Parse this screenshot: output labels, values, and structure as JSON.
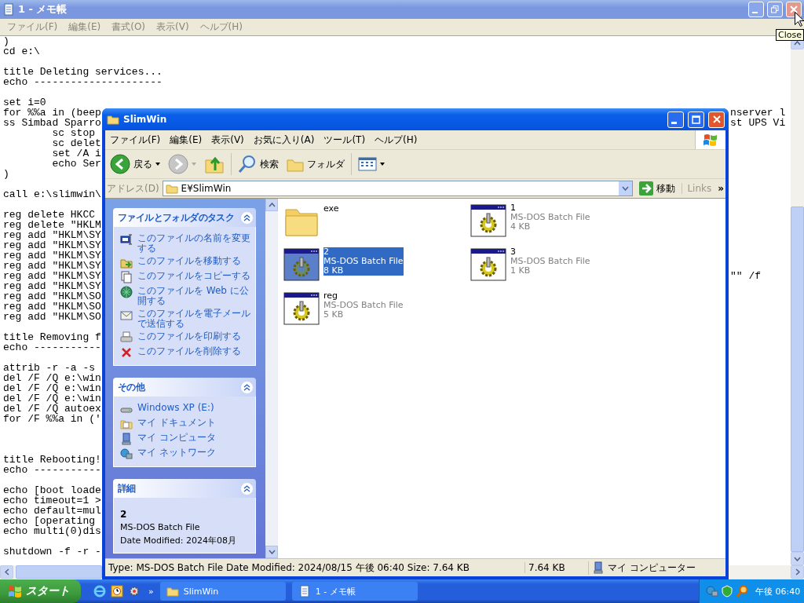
{
  "notepad": {
    "title": "1 - メモ帳",
    "menu": [
      "ファイル(F)",
      "編集(E)",
      "書式(O)",
      "表示(V)",
      "ヘルプ(H)"
    ],
    "tooltip": "Close",
    "lines": [
      {
        "kind": "code",
        "text": ")"
      },
      {
        "kind": "code",
        "text": "cd e:\\"
      },
      {
        "kind": "blank"
      },
      {
        "kind": "code",
        "text": "title Deleting services..."
      },
      {
        "kind": "code",
        "text": "echo ---------------------"
      },
      {
        "kind": "blank"
      },
      {
        "kind": "code",
        "text": "set i=0"
      },
      {
        "kind": "code",
        "text": "for %%a in (beep",
        "tail": "nserver l"
      },
      {
        "kind": "code",
        "text": "ss Simbad Sparro",
        "tail": "st UPS Vi"
      },
      {
        "kind": "code",
        "text": "        sc stop"
      },
      {
        "kind": "code",
        "text": "        sc delet"
      },
      {
        "kind": "code",
        "text": "        set /A i"
      },
      {
        "kind": "code",
        "text": "        echo Ser"
      },
      {
        "kind": "code",
        "text": ")"
      },
      {
        "kind": "blank"
      },
      {
        "kind": "code",
        "text": "call e:\\slimwin\\"
      },
      {
        "kind": "blank"
      },
      {
        "kind": "code",
        "text": "reg delete HKCC"
      },
      {
        "kind": "code",
        "text": "reg delete \"HKLM"
      },
      {
        "kind": "code",
        "text": "reg add \"HKLM\\SY"
      },
      {
        "kind": "code",
        "text": "reg add \"HKLM\\SY"
      },
      {
        "kind": "code",
        "text": "reg add \"HKLM\\SY"
      },
      {
        "kind": "code",
        "text": "reg add \"HKLM\\SY"
      },
      {
        "kind": "code",
        "text": "reg add \"HKLM\\SY",
        "tail": "\"\" /f"
      },
      {
        "kind": "code",
        "text": "reg add \"HKLM\\SY"
      },
      {
        "kind": "code",
        "text": "reg add \"HKLM\\SO"
      },
      {
        "kind": "code",
        "text": "reg add \"HKLM\\SO"
      },
      {
        "kind": "code",
        "text": "reg add \"HKLM\\SO"
      },
      {
        "kind": "blank"
      },
      {
        "kind": "code",
        "text": "title Removing f"
      },
      {
        "kind": "code",
        "text": "echo -----------"
      },
      {
        "kind": "blank"
      },
      {
        "kind": "code",
        "text": "attrib -r -a -s"
      },
      {
        "kind": "code",
        "text": "del /F /Q e:\\win"
      },
      {
        "kind": "code",
        "text": "del /F /Q e:\\win"
      },
      {
        "kind": "code",
        "text": "del /F /Q e:\\win"
      },
      {
        "kind": "code",
        "text": "del /F /Q autoex"
      },
      {
        "kind": "code",
        "text": "for /F %%a in ('"
      },
      {
        "kind": "blank"
      },
      {
        "kind": "blank"
      },
      {
        "kind": "blank"
      },
      {
        "kind": "code",
        "text": "title Rebooting!"
      },
      {
        "kind": "code",
        "text": "echo -----------"
      },
      {
        "kind": "blank"
      },
      {
        "kind": "code",
        "text": "echo [boot loade"
      },
      {
        "kind": "code",
        "text": "echo timeout=1 >"
      },
      {
        "kind": "code",
        "text": "echo default=mul"
      },
      {
        "kind": "code",
        "text": "echo [operating"
      },
      {
        "kind": "code",
        "text": "echo multi(0)dis"
      },
      {
        "kind": "blank"
      },
      {
        "kind": "code",
        "text": "shutdown -f -r -"
      }
    ]
  },
  "explorer": {
    "title": "SlimWin",
    "menu": [
      "ファイル(F)",
      "編集(E)",
      "表示(V)",
      "お気に入り(A)",
      "ツール(T)",
      "ヘルプ(H)"
    ],
    "toolbar": {
      "back": "戻る",
      "search": "検索",
      "folders": "フォルダ"
    },
    "address": {
      "label": "アドレス(D)",
      "value": "E¥SlimWin",
      "go": "移動",
      "links": "Links",
      "links_more": "»"
    },
    "task_panes": [
      {
        "title": "ファイルとフォルダのタスク",
        "items": [
          {
            "kind": "rename",
            "label": "このファイルの名前を変更する"
          },
          {
            "kind": "move",
            "label": "このファイルを移動する"
          },
          {
            "kind": "copy",
            "label": "このファイルをコピーする"
          },
          {
            "kind": "publish",
            "label": "このファイルを Web に公開する"
          },
          {
            "kind": "email",
            "label": "このファイルを電子メールで送信する"
          },
          {
            "kind": "print",
            "label": "このファイルを印刷する"
          },
          {
            "kind": "delete",
            "label": "このファイルを削除する"
          }
        ]
      },
      {
        "title": "その他",
        "items": [
          {
            "kind": "drive",
            "label": "Windows XP (E:)"
          },
          {
            "kind": "documents",
            "label": "マイ ドキュメント"
          },
          {
            "kind": "computer",
            "label": "マイ コンピュータ"
          },
          {
            "kind": "network",
            "label": "マイ ネットワーク"
          }
        ]
      }
    ],
    "details": {
      "title": "詳細",
      "name": "2",
      "type": "MS-DOS Batch File",
      "modified": "Date Modified: 2024年08月"
    },
    "files": [
      {
        "kind": "folder",
        "name": "exe",
        "selected": false
      },
      {
        "kind": "batch",
        "name": "1",
        "type": "MS-DOS Batch File",
        "size": "4 KB",
        "selected": false
      },
      {
        "kind": "batch",
        "name": "2",
        "type": "MS-DOS Batch File",
        "size": "8 KB",
        "selected": true
      },
      {
        "kind": "batch",
        "name": "3",
        "type": "MS-DOS Batch File",
        "size": "1 KB",
        "selected": false
      },
      {
        "kind": "batch",
        "name": "reg",
        "type": "MS-DOS Batch File",
        "size": "5 KB",
        "selected": false
      }
    ],
    "status_bar": {
      "info": "Type: MS-DOS Batch File Date Modified: 2024/08/15 午後 06:40 Size: 7.64 KB",
      "size": "7.64 KB",
      "zone": "マイ コンピューター"
    }
  },
  "taskbar": {
    "start": "スタート",
    "quick_launch_more": "»",
    "tasks": [
      {
        "kind": "folder",
        "label": "SlimWin"
      },
      {
        "kind": "notepad",
        "label": "1 - メモ帳"
      }
    ],
    "clock": "午後 06:40"
  }
}
